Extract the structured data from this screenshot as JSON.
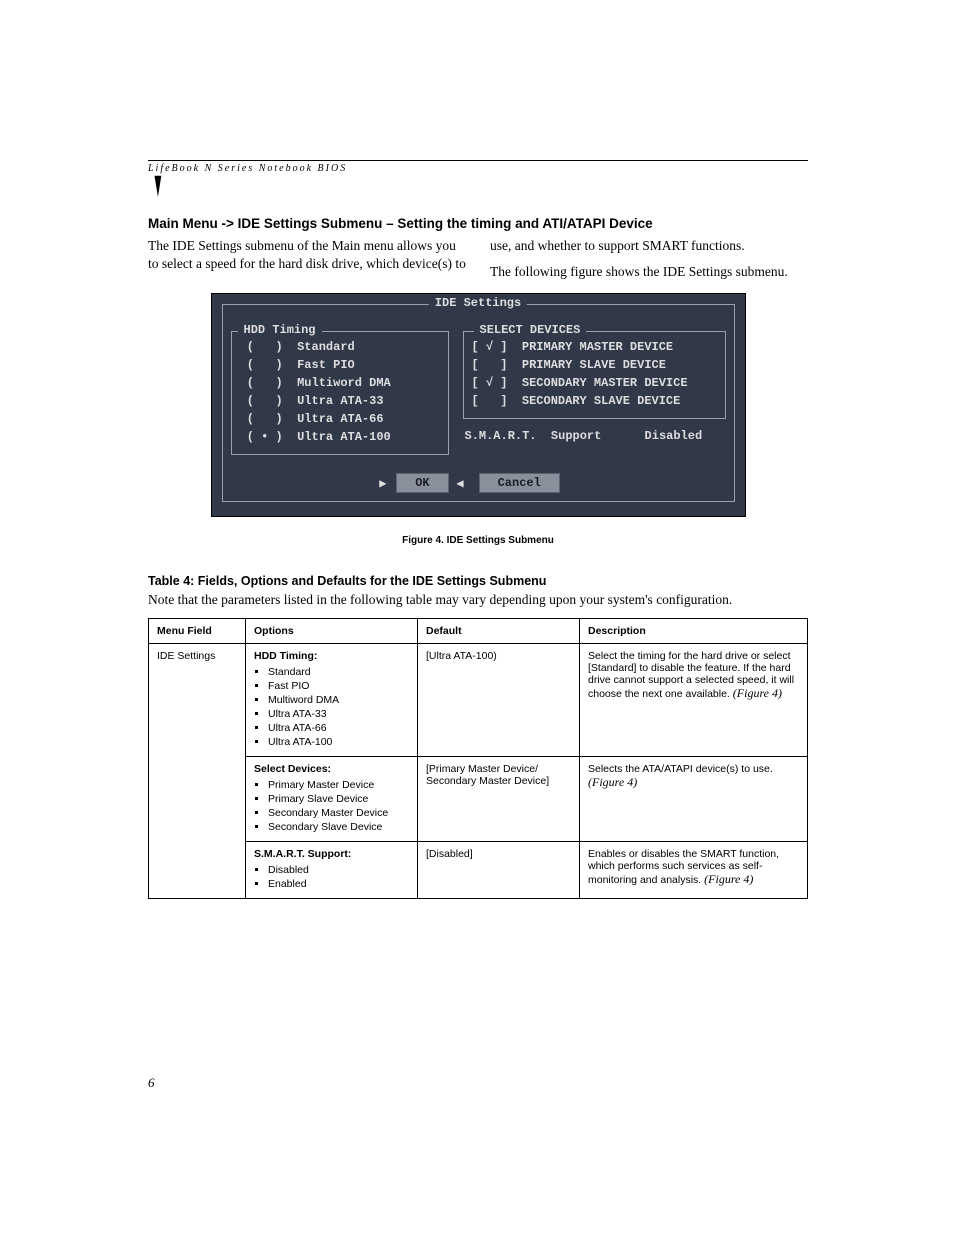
{
  "running_head": "LifeBook N Series Notebook BIOS",
  "section_title": "Main Menu -> IDE Settings Submenu – Setting the timing and ATI/ATAPI Device",
  "intro_left": "The IDE Settings submenu of the Main menu allows you to select a speed for the hard disk drive, which device(s) to use, and whether to support SMART functions.",
  "intro_right": "The following figure shows the IDE Settings submenu.",
  "bios": {
    "title": "IDE Settings",
    "hdd_legend": "HDD Timing",
    "hdd_options": [
      "Standard",
      "Fast PIO",
      "Multiword DMA",
      "Ultra ATA-33",
      "Ultra ATA-66",
      "Ultra ATA-100"
    ],
    "hdd_selected": 5,
    "dev_legend": "SELECT DEVICES",
    "dev_options": [
      {
        "label": "PRIMARY MASTER DEVICE",
        "checked": true
      },
      {
        "label": "PRIMARY SLAVE DEVICE",
        "checked": false
      },
      {
        "label": "SECONDARY MASTER DEVICE",
        "checked": true
      },
      {
        "label": "SECONDARY SLAVE DEVICE",
        "checked": false
      }
    ],
    "smart_label": "S.M.A.R.T.  Support",
    "smart_value": "Disabled",
    "ok": "OK",
    "cancel": "Cancel"
  },
  "fig_caption": "Figure 4. IDE Settings Submenu",
  "table_title": "Table 4: Fields, Options and Defaults for the IDE Settings Submenu",
  "table_note": "Note that the parameters listed in the following table may vary depending upon your system's configuration.",
  "headers": {
    "menu": "Menu Field",
    "options": "Options",
    "def": "Default",
    "desc": "Description"
  },
  "rows": [
    {
      "menu": "IDE Settings",
      "opt_head": "HDD Timing:",
      "opts": [
        "Standard",
        "Fast PIO",
        "Multiword DMA",
        "Ultra ATA-33",
        "Ultra ATA-66",
        "Ultra ATA-100"
      ],
      "def": "[Ultra ATA-100)",
      "desc": "Select the timing for the hard drive or select [Standard] to disable the feature. If the hard drive cannot support a selected speed, it will choose the next one available.",
      "fig": "(Figure 4)"
    },
    {
      "opt_head": "Select Devices:",
      "opts": [
        "Primary Master Device",
        "Primary Slave Device",
        "Secondary Master Device",
        "Secondary Slave Device"
      ],
      "def": "[Primary Master Device/ Secondary Master Device]",
      "desc": "Selects the ATA/ATAPI device(s) to use.",
      "fig": "(Figure 4)"
    },
    {
      "opt_head": "S.M.A.R.T. Support:",
      "opts": [
        "Disabled",
        "Enabled"
      ],
      "def": "[Disabled]",
      "desc": "Enables or disables the SMART function, which performs such services as self-monitoring and analysis.",
      "fig": "(Figure 4)"
    }
  ],
  "page_number": "6"
}
